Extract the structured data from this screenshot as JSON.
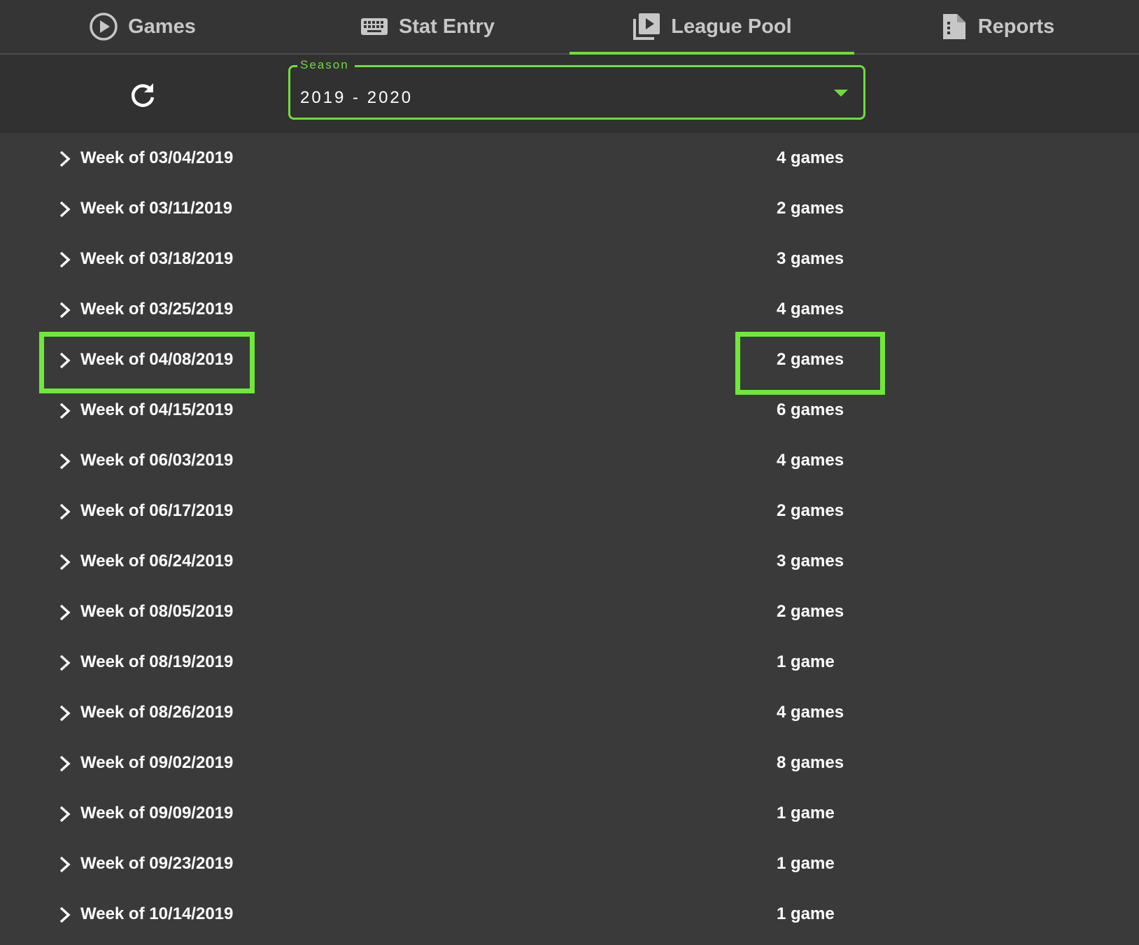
{
  "tabs": [
    {
      "label": "Games",
      "icon": "play-circle-icon",
      "active": false
    },
    {
      "label": "Stat Entry",
      "icon": "keyboard-icon",
      "active": false
    },
    {
      "label": "League Pool",
      "icon": "video-library-icon",
      "active": true
    },
    {
      "label": "Reports",
      "icon": "document-icon",
      "active": false
    }
  ],
  "filter": {
    "refresh_icon": "refresh-icon",
    "season_label": "Season",
    "season_value": "2019 - 2020"
  },
  "colors": {
    "accent": "#6fdc3b",
    "highlight": "#6fe83a",
    "background": "#3a3a3a"
  },
  "weeks": [
    {
      "label": "Week of 03/04/2019",
      "count": "4 games"
    },
    {
      "label": "Week of 03/11/2019",
      "count": "2 games"
    },
    {
      "label": "Week of 03/18/2019",
      "count": "3 games"
    },
    {
      "label": "Week of 03/25/2019",
      "count": "4 games"
    },
    {
      "label": "Week of 04/08/2019",
      "count": "2 games",
      "highlighted": true
    },
    {
      "label": "Week of 04/15/2019",
      "count": "6 games"
    },
    {
      "label": "Week of 06/03/2019",
      "count": "4 games"
    },
    {
      "label": "Week of 06/17/2019",
      "count": "2 games"
    },
    {
      "label": "Week of 06/24/2019",
      "count": "3 games"
    },
    {
      "label": "Week of 08/05/2019",
      "count": "2 games"
    },
    {
      "label": "Week of 08/19/2019",
      "count": "1 game"
    },
    {
      "label": "Week of 08/26/2019",
      "count": "4 games"
    },
    {
      "label": "Week of 09/02/2019",
      "count": "8 games"
    },
    {
      "label": "Week of 09/09/2019",
      "count": "1 game"
    },
    {
      "label": "Week of 09/23/2019",
      "count": "1 game"
    },
    {
      "label": "Week of 10/14/2019",
      "count": "1 game"
    }
  ]
}
